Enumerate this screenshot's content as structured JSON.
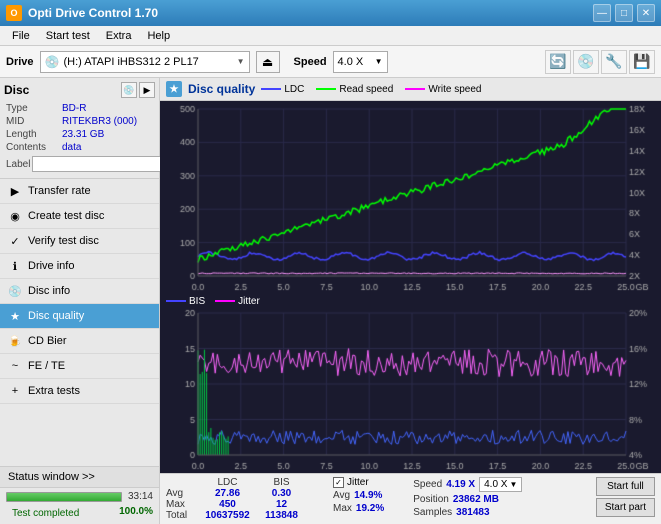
{
  "window": {
    "title": "Opti Drive Control 1.70",
    "icon": "ODC",
    "min_btn": "—",
    "max_btn": "□",
    "close_btn": "✕"
  },
  "menu": {
    "items": [
      "File",
      "Start test",
      "Extra",
      "Help"
    ]
  },
  "drive_bar": {
    "label": "Drive",
    "drive_value": "(H:) ATAPI iHBS312  2 PL17",
    "speed_label": "Speed",
    "speed_value": "4.0 X"
  },
  "disc": {
    "title": "Disc",
    "type_label": "Type",
    "type_value": "BD-R",
    "mid_label": "MID",
    "mid_value": "RITEKBR3 (000)",
    "length_label": "Length",
    "length_value": "23.31 GB",
    "contents_label": "Contents",
    "contents_value": "data",
    "label_label": "Label"
  },
  "nav": {
    "items": [
      {
        "id": "transfer-rate",
        "label": "Transfer rate",
        "icon": "▶"
      },
      {
        "id": "create-test-disc",
        "label": "Create test disc",
        "icon": "◉"
      },
      {
        "id": "verify-test-disc",
        "label": "Verify test disc",
        "icon": "✓"
      },
      {
        "id": "drive-info",
        "label": "Drive info",
        "icon": "ℹ"
      },
      {
        "id": "disc-info",
        "label": "Disc info",
        "icon": "💿"
      },
      {
        "id": "disc-quality",
        "label": "Disc quality",
        "icon": "★",
        "active": true
      },
      {
        "id": "cd-bier",
        "label": "CD Bier",
        "icon": "🍺"
      },
      {
        "id": "fe-te",
        "label": "FE / TE",
        "icon": "~"
      },
      {
        "id": "extra-tests",
        "label": "Extra tests",
        "icon": "+"
      }
    ],
    "status_btn": "Status window >>",
    "status_text": "Test completed",
    "progress": 100.0,
    "progress_display": "100.0%",
    "time": "33:14"
  },
  "chart": {
    "title": "Disc quality",
    "icon": "★",
    "legend": [
      {
        "label": "LDC",
        "color": "#4444ff"
      },
      {
        "label": "Read speed",
        "color": "#00ff00"
      },
      {
        "label": "Write speed",
        "color": "#ff00ff"
      }
    ],
    "legend2": [
      {
        "label": "BIS",
        "color": "#4444ff"
      },
      {
        "label": "Jitter",
        "color": "#ff00ff"
      }
    ],
    "x_axis": [
      "0.0",
      "2.5",
      "5.0",
      "7.5",
      "10.0",
      "12.5",
      "15.0",
      "17.5",
      "20.0",
      "22.5",
      "25.0"
    ],
    "y_axis_top": [
      "500",
      "400",
      "300",
      "200",
      "100",
      "0"
    ],
    "y_axis_right_top": [
      "18X",
      "16X",
      "14X",
      "12X",
      "10X",
      "8X",
      "6X",
      "4X",
      "2X"
    ],
    "y_axis_bottom": [
      "20",
      "15",
      "10",
      "5",
      "0"
    ],
    "y_axis_right_bottom": [
      "20%",
      "16%",
      "12%",
      "8%",
      "4%"
    ]
  },
  "stats": {
    "ldc_label": "LDC",
    "bis_label": "BIS",
    "jitter_label": "Jitter",
    "speed_label": "Speed",
    "avg_label": "Avg",
    "max_label": "Max",
    "total_label": "Total",
    "ldc_avg": "27.86",
    "ldc_max": "450",
    "ldc_total": "10637592",
    "bis_avg": "0.30",
    "bis_max": "12",
    "bis_total": "113848",
    "jitter_checked": true,
    "jitter_avg": "14.9%",
    "jitter_max": "19.2%",
    "speed_value": "4.19 X",
    "speed_select": "4.0 X",
    "position_label": "Position",
    "position_value": "23862 MB",
    "samples_label": "Samples",
    "samples_value": "381483",
    "start_full_btn": "Start full",
    "start_part_btn": "Start part"
  }
}
